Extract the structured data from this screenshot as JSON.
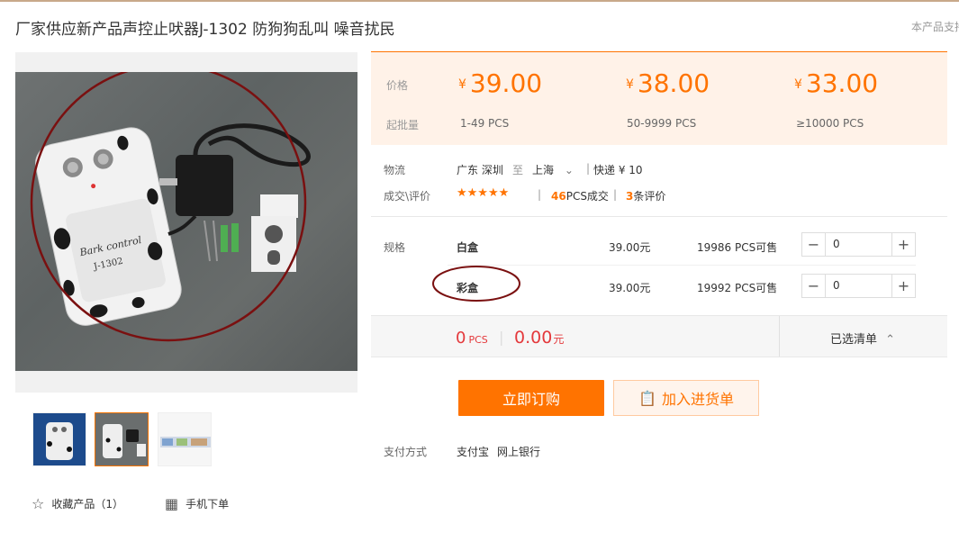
{
  "header": {
    "title": "厂家供应新产品声控止吠器J-1302 防狗狗乱叫 噪音扰民",
    "support_text": "本产品支持"
  },
  "pricing": {
    "price_label": "价格",
    "moq_label": "起批量",
    "currency": "¥",
    "tiers": [
      {
        "price": "39.00",
        "range": "1-49  PCS"
      },
      {
        "price": "38.00",
        "range": "50-9999  PCS"
      },
      {
        "price": "33.00",
        "range": "≥10000  PCS"
      }
    ]
  },
  "logistics": {
    "label": "物流",
    "from": "广东 深圳",
    "to_word": "至",
    "to": "上海",
    "shipping": "快递 ¥ 10"
  },
  "deals": {
    "label": "成交\\评价",
    "rating": 5,
    "stars": "★★★★★",
    "sold_count": "46",
    "sold_unit": "PCS成交",
    "review_count": "3",
    "review_unit": "条评价"
  },
  "specs": {
    "label": "规格",
    "items": [
      {
        "name": "白盒",
        "price": "39.00元",
        "stock": "19986 PCS可售",
        "qty": "0"
      },
      {
        "name": "彩盒",
        "price": "39.00元",
        "stock": "19992 PCS可售",
        "qty": "0"
      }
    ]
  },
  "summary": {
    "count": "0",
    "count_unit": "PCS",
    "total": "0.00",
    "total_unit": "元",
    "list_label": "已选清单"
  },
  "actions": {
    "buy_now": "立即订购",
    "add_to_list": "加入进货单"
  },
  "payment": {
    "label": "支付方式",
    "methods": [
      "支付宝",
      "网上银行"
    ]
  },
  "footer": {
    "favorite": "收藏产品（1）",
    "mobile_order": "手机下单"
  },
  "product_photo": {
    "label_line1": "Bark control",
    "label_line2": "J-1302"
  },
  "colors": {
    "accent": "#ff7300",
    "price_bg": "#fff2e8",
    "summary_red": "#e4393c",
    "annotation_circle": "#7a1010"
  },
  "icons": {
    "favorite": "star-outline-icon",
    "mobile": "qr-code-icon",
    "cart": "clipboard-icon",
    "dropdown": "chevron-down-icon",
    "collapse": "chevron-up-icon"
  }
}
